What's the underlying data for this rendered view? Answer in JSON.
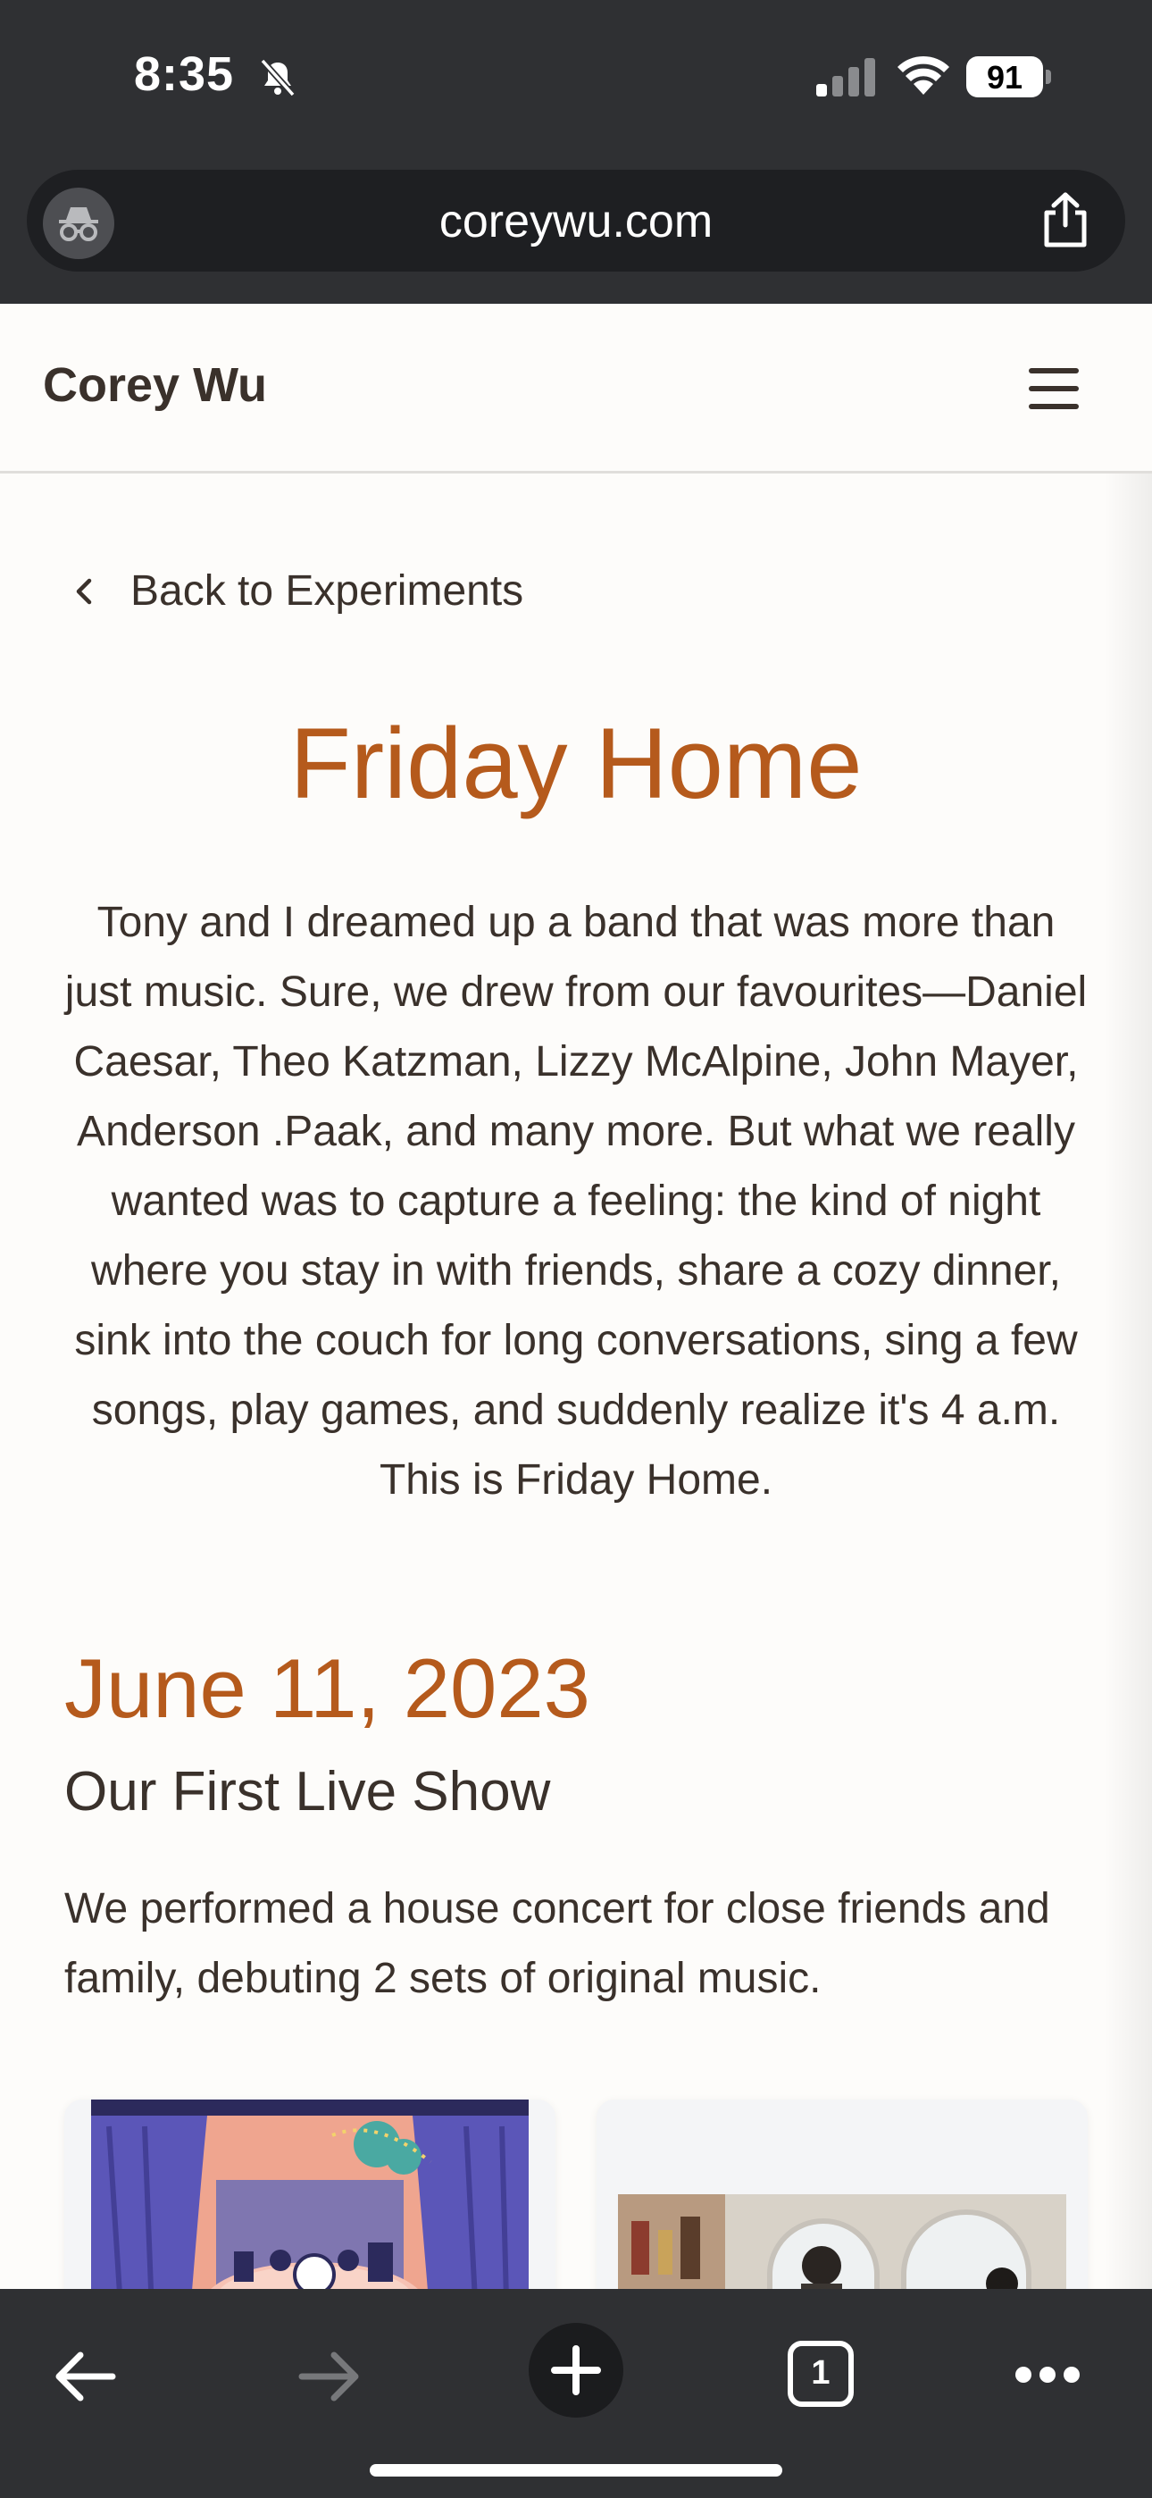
{
  "status_bar": {
    "time": "8:35",
    "battery": "91"
  },
  "browser": {
    "url": "coreywu.com"
  },
  "site": {
    "brand": "Corey Wu"
  },
  "back_link": "Back to Experiments",
  "page": {
    "title": "Friday Home",
    "intro": "Tony and I dreamed up a band that was more than just music. Sure, we drew from our favourites—Daniel Caesar, Theo Katzman, Lizzy McAlpine, John Mayer, Anderson .Paak, and many more. But what we really wanted was to capture a feeling: the kind of night where you stay in with friends, share a cozy dinner, sink into the couch for long conversations, sing a few songs, play games, and suddenly realize it's 4 a.m. This is Friday Home."
  },
  "entry": {
    "date": "June 11, 2023",
    "heading": "Our First Live Show",
    "text": "We performed a house concert for close friends and family, debuting 2 sets of original music."
  },
  "toolbar": {
    "tab_count": "1"
  },
  "icons": {
    "silent": "bell-slash-icon",
    "incognito": "incognito-icon",
    "share": "share-icon",
    "menu": "hamburger-menu-icon",
    "back": "chevron-left-icon",
    "nav_back": "arrow-left-icon",
    "nav_forward": "arrow-right-icon",
    "new_tab": "plus-icon",
    "more": "ellipsis-icon"
  },
  "colors": {
    "accent": "#b55a1c",
    "text": "#3a312b",
    "chrome": "#2f3033",
    "page_bg": "#fdfcfa"
  }
}
